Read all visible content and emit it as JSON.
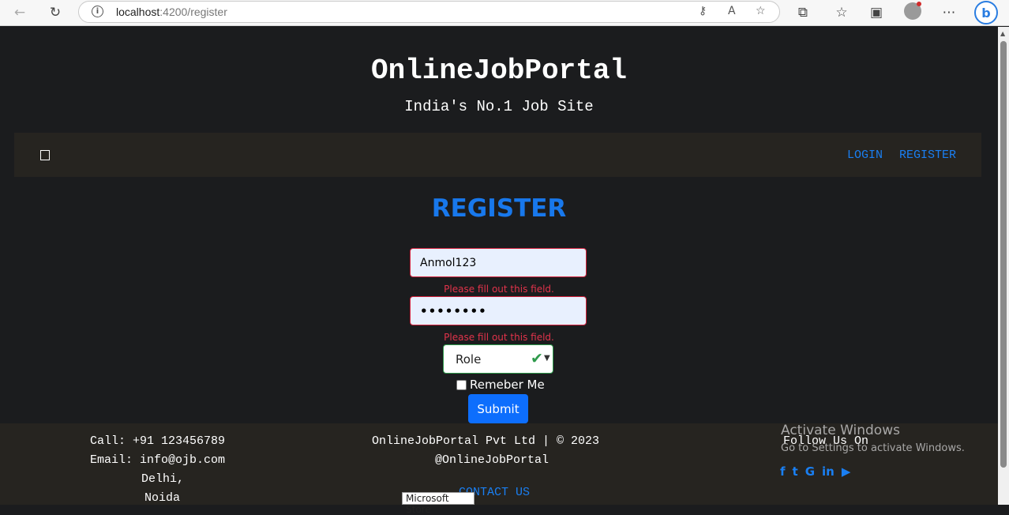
{
  "browser": {
    "url_host": "localhost",
    "url_rest": ":4200/register",
    "icons": [
      "back-icon",
      "reload-icon",
      "site-info-icon",
      "key-icon",
      "read-aloud-icon",
      "favorite-add-icon",
      "extensions-icon",
      "favorites-icon",
      "collections-icon",
      "profile-icon",
      "more-icon",
      "bing-icon"
    ]
  },
  "header": {
    "title": "OnlineJobPortal",
    "subtitle": "India's No.1 Job Site"
  },
  "nav": {
    "login": "LOGIN",
    "register": "REGISTER"
  },
  "form": {
    "title": "REGISTER",
    "username_value": "Anmol123",
    "password_value": "••••••••",
    "error_message": "Please fill out this field.",
    "role_selected": "Role",
    "remember_label": "Remeber Me",
    "submit_label": "Submit"
  },
  "footer": {
    "call": "Call: +91 123456789",
    "email": "Email: info@ojb.com",
    "city": "Delhi,",
    "city2": "Noida",
    "company": "OnlineJobPortal Pvt Ltd | © 2023",
    "handle": "@OnlineJobPortal",
    "contact": "CONTACT US",
    "follow": "Follow Us On",
    "social_icons": [
      "facebook-icon",
      "twitter-icon",
      "google-icon",
      "linkedin-icon",
      "youtube-icon"
    ]
  },
  "overlay": {
    "activate_title": "Activate Windows",
    "activate_sub": "Go to Settings to activate Windows.",
    "tooltip": "Microsoft Store"
  },
  "colors": {
    "page_bg": "#1b1c1e",
    "accent_blue": "#1878ec",
    "error_red": "#e2334b",
    "success_green": "#2e9a4b"
  }
}
